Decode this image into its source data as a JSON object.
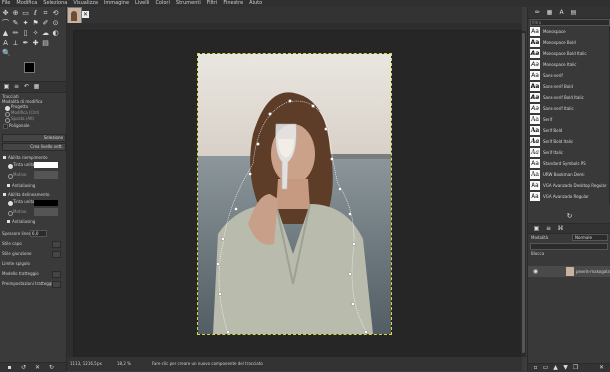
{
  "menu": [
    "File",
    "Modifica",
    "Seleziona",
    "Visualizza",
    "Immagine",
    "Livelli",
    "Colori",
    "Strumenti",
    "Filtri",
    "Finestre",
    "Aiuto"
  ],
  "tool_options": {
    "title": "Tracciati",
    "mode_label": "Modalità di modifica",
    "modes": [
      "Progetta",
      "Modifica (Ctrl)",
      "Sposta (Alt)"
    ],
    "polygon": "Poligonale",
    "selection_btn": "Selezione",
    "create_layer_btn": "Crea livello vett.",
    "fill_title": "Abilita riempimento",
    "solid_color": "Tinta unita",
    "pattern": "Motivo",
    "antialias": "Antialiasing",
    "stroke_title": "Abilita delineamento",
    "stroke_solid": "Tinta unita",
    "stroke_pattern": "Motivo",
    "stroke_antialias": "Antialiasing",
    "line_width_label": "Spessore linea",
    "line_width_value": "6,0",
    "cap_style": "Stile capo",
    "join_style": "Stile giunzione",
    "miter_limit": "Limite spigolo",
    "dash_pattern": "Modello tratteggio",
    "dash_preset": "Preimpostazioni tratteggio"
  },
  "status": {
    "coords": "1113, 1216,5",
    "unit": "px",
    "zoom": "18,2 %",
    "hint": "Fare clic per creare un nuovo componente del tracciato"
  },
  "fonts": {
    "filter_placeholder": "filtro",
    "items": [
      "Monospace",
      "Monospace Bold",
      "Monospace Bold Italic",
      "Monospace Italic",
      "Sans-serif",
      "Sans-serif Bold",
      "Sans-serif Bold Italic",
      "Sans-serif Italic",
      "Serif",
      "Serif Bold",
      "Serif Bold Italic",
      "Serif Italic",
      "Standard Symbols PS",
      "URW Bookman Demi",
      "VGA Avanzado Desktop Regular",
      "VGA Avanzado Regular"
    ],
    "preview": "Aa"
  },
  "layers": {
    "mode_label": "Modalità",
    "mode_value": "Normale",
    "lock_label": "Blocca",
    "layer_name": "pexels-makogolatie"
  },
  "colors": {
    "fg": "#000000",
    "bg": "#ffffff",
    "accent": "#e8e8e8"
  }
}
